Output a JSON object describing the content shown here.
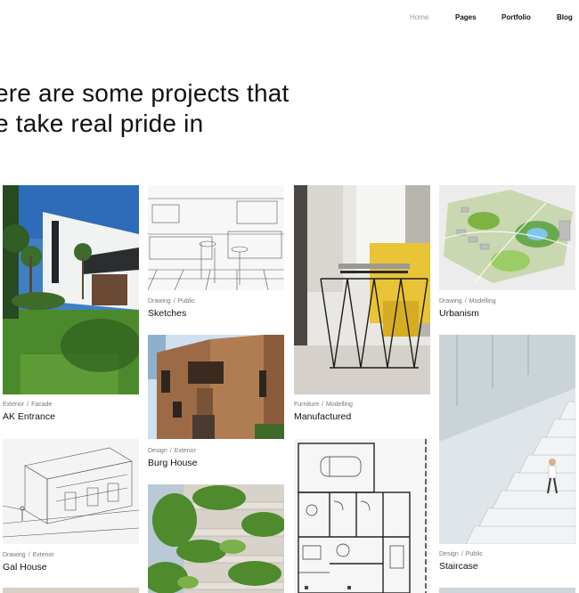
{
  "nav": {
    "items": [
      {
        "label": "Home",
        "active": true
      },
      {
        "label": "Pages",
        "active": false
      },
      {
        "label": "Portfolio",
        "active": false
      },
      {
        "label": "Blog",
        "active": false
      }
    ]
  },
  "hero": {
    "line1": "ere are some projects that",
    "line2": "e take real pride in"
  },
  "projects": [
    {
      "category": "Exterior",
      "subcategory": "Facade",
      "title": "AK Entrance",
      "image": "modern-white-house-photo"
    },
    {
      "category": "Drawing",
      "subcategory": "Public",
      "title": "Sketches",
      "image": "kitchen-sketch-drawing"
    },
    {
      "category": "Furniture",
      "subcategory": "Modelling",
      "title": "Manufactured",
      "image": "wire-table-yellow-chair-photo"
    },
    {
      "category": "Drawing",
      "subcategory": "Modelling",
      "title": "Urbanism",
      "image": "urban-site-model-render"
    },
    {
      "category": "Design",
      "subcategory": "Exterior",
      "title": "Burg House",
      "image": "wooden-facade-building-photo"
    },
    {
      "category": "Drawing",
      "subcategory": "Exterior",
      "title": "Gal House",
      "image": "house-line-drawing"
    },
    {
      "category": "Design",
      "subcategory": "Public",
      "title": "Staircase",
      "image": "white-staircase-photo"
    },
    {
      "category": "",
      "subcategory": "",
      "title": "",
      "image": "green-terraces-building-photo"
    },
    {
      "category": "",
      "subcategory": "",
      "title": "",
      "image": "floor-plan-drawing"
    }
  ],
  "colors": {
    "text": "#111111",
    "muted": "#777777",
    "nav_active": "#9a9a9a"
  }
}
